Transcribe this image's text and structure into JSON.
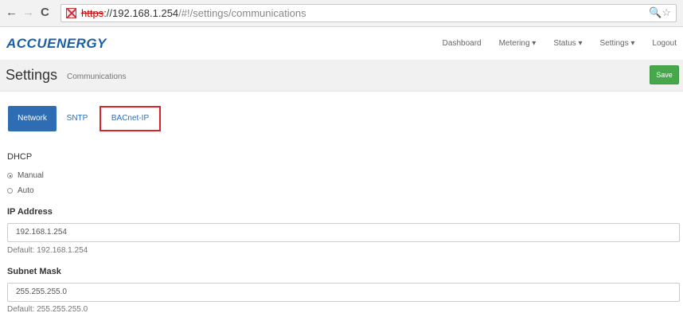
{
  "browser": {
    "url_scheme": "https",
    "url_host": "://192.168.1.254",
    "url_path": "/#!/settings/communications",
    "icons": {
      "back": "arrow-left-icon",
      "forward": "arrow-right-icon",
      "reload": "reload-icon",
      "security": "insecure-lock-icon",
      "zoom": "magnifier-icon",
      "bookmark": "star-icon"
    }
  },
  "app": {
    "logo": "ACCUENERGY",
    "menu": [
      "Dashboard",
      "Metering ▾",
      "Status ▾",
      "Settings ▾",
      "Logout"
    ]
  },
  "header": {
    "title": "Settings",
    "subtitle": "Communications",
    "save_label": "Save"
  },
  "tabs": [
    "Network",
    "SNTP",
    "BACnet-IP"
  ],
  "form": {
    "dhcp_label": "DHCP",
    "dhcp_options": [
      "Manual",
      "Auto"
    ],
    "dhcp_selected": "Manual",
    "ip_label": "IP Address",
    "ip_value": "192.168.1.254",
    "ip_default": "Default: 192.168.1.254",
    "mask_label": "Subnet Mask",
    "mask_value": "255.255.255.0",
    "mask_default": "Default: 255.255.255.0"
  },
  "colors": {
    "brand": "#1c5ea6",
    "tab_active": "#2e6db4",
    "save": "#46a84a",
    "highlight_box": "#d9232b"
  }
}
